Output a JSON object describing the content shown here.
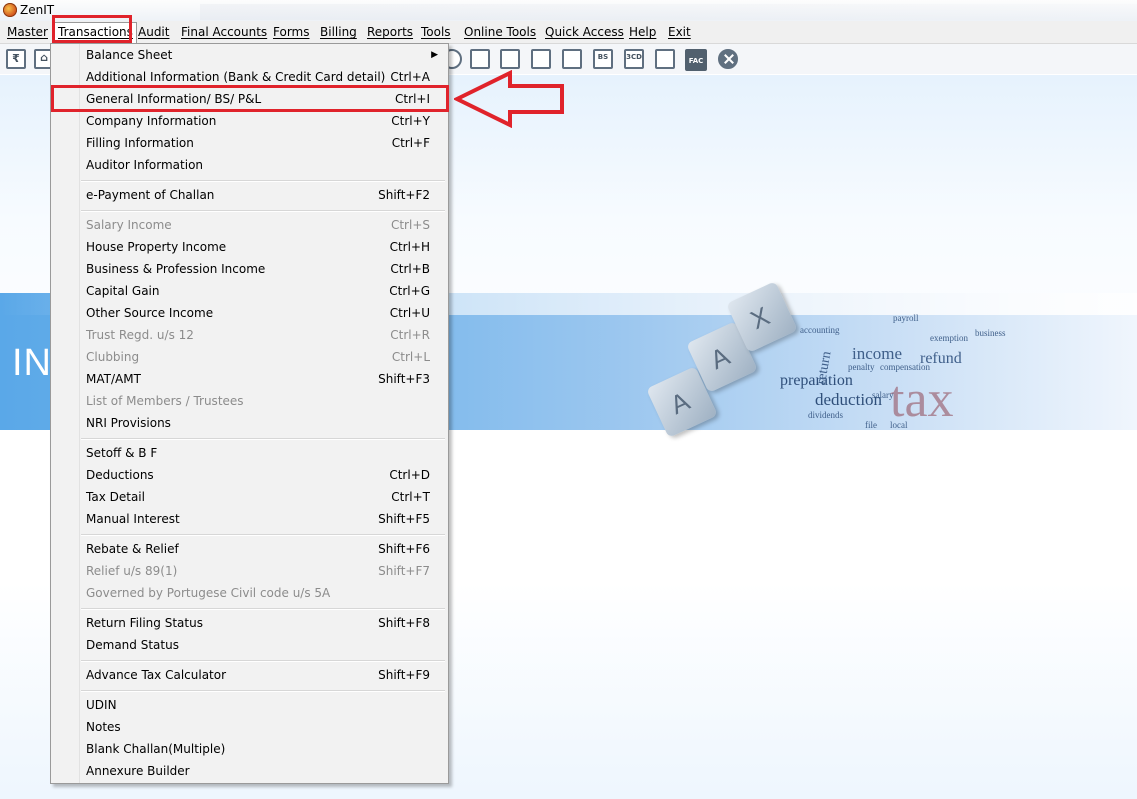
{
  "window": {
    "title": "ZenIT"
  },
  "menubar": [
    {
      "label": "Master"
    },
    {
      "label": "Transactions"
    },
    {
      "label": "Audit"
    },
    {
      "label": "Final Accounts"
    },
    {
      "label": "Forms"
    },
    {
      "label": "Billing"
    },
    {
      "label": "Reports"
    },
    {
      "label": "Tools"
    },
    {
      "label": "Online Tools"
    },
    {
      "label": "Quick Access"
    },
    {
      "label": "Help"
    },
    {
      "label": "Exit"
    }
  ],
  "toolbar": {
    "icons": [
      "rupee-icon",
      "home-icon",
      "search-icon",
      "calculator-icon",
      "user-card-icon",
      "calendar-icon",
      "folder-add-icon",
      "bs-icon",
      "3cd-icon",
      "report-icon",
      "fac-icon",
      "close-icon"
    ],
    "bs_label": "BS",
    "cd_label": "3CD",
    "fac_label": "FAC"
  },
  "banner": {
    "left_text": "INC",
    "keys": [
      "A",
      "A",
      "X"
    ],
    "words": [
      "tax",
      "income",
      "refund",
      "preparation",
      "deduction",
      "return",
      "dividends",
      "payroll",
      "accounting",
      "penalty",
      "compensation",
      "salary",
      "exemption",
      "local",
      "file",
      "business"
    ]
  },
  "dropdown": {
    "items": [
      {
        "label": "Balance Sheet",
        "shortcut": "",
        "submenu": true,
        "enabled": true
      },
      {
        "label": "Additional Information (Bank & Credit Card detail)",
        "shortcut": "Ctrl+A",
        "enabled": true
      },
      {
        "label": "General Information/ BS/ P&L",
        "shortcut": "Ctrl+I",
        "enabled": true,
        "highlighted": true
      },
      {
        "label": "Company Information",
        "shortcut": "Ctrl+Y",
        "enabled": true
      },
      {
        "label": "Filling Information",
        "shortcut": "Ctrl+F",
        "enabled": true
      },
      {
        "label": "Auditor Information",
        "shortcut": "",
        "enabled": true
      },
      {
        "label": "e-Payment of Challan",
        "shortcut": "Shift+F2",
        "enabled": true
      },
      {
        "label": "Salary Income",
        "shortcut": "Ctrl+S",
        "enabled": false
      },
      {
        "label": "House Property Income",
        "shortcut": "Ctrl+H",
        "enabled": true
      },
      {
        "label": "Business & Profession Income",
        "shortcut": "Ctrl+B",
        "enabled": true
      },
      {
        "label": "Capital Gain",
        "shortcut": "Ctrl+G",
        "enabled": true
      },
      {
        "label": "Other Source Income",
        "shortcut": "Ctrl+U",
        "enabled": true
      },
      {
        "label": "Trust Regd. u/s 12",
        "shortcut": "Ctrl+R",
        "enabled": false
      },
      {
        "label": "Clubbing",
        "shortcut": "Ctrl+L",
        "enabled": false
      },
      {
        "label": "MAT/AMT",
        "shortcut": "Shift+F3",
        "enabled": true
      },
      {
        "label": "List of Members / Trustees",
        "shortcut": "",
        "enabled": false
      },
      {
        "label": "NRI Provisions",
        "shortcut": "",
        "enabled": true
      },
      {
        "label": "Setoff & B F",
        "shortcut": "",
        "enabled": true
      },
      {
        "label": "Deductions",
        "shortcut": "Ctrl+D",
        "enabled": true
      },
      {
        "label": "Tax Detail",
        "shortcut": "Ctrl+T",
        "enabled": true
      },
      {
        "label": "Manual Interest",
        "shortcut": "Shift+F5",
        "enabled": true
      },
      {
        "label": "Rebate & Relief",
        "shortcut": "Shift+F6",
        "enabled": true
      },
      {
        "label": "Relief u/s 89(1)",
        "shortcut": "Shift+F7",
        "enabled": false
      },
      {
        "label": "Governed by Portugese Civil code u/s 5A",
        "shortcut": "",
        "enabled": false
      },
      {
        "label": "Return Filing Status",
        "shortcut": "Shift+F8",
        "enabled": true
      },
      {
        "label": "Demand Status",
        "shortcut": "",
        "enabled": true
      },
      {
        "label": "Advance Tax Calculator",
        "shortcut": "Shift+F9",
        "enabled": true
      },
      {
        "label": "UDIN",
        "shortcut": "",
        "enabled": true
      },
      {
        "label": "Notes",
        "shortcut": "",
        "enabled": true
      },
      {
        "label": "Blank Challan(Multiple)",
        "shortcut": "",
        "enabled": true
      },
      {
        "label": "Annexure Builder",
        "shortcut": "",
        "enabled": true
      }
    ]
  },
  "annotation": {
    "color": "#e0232b"
  }
}
